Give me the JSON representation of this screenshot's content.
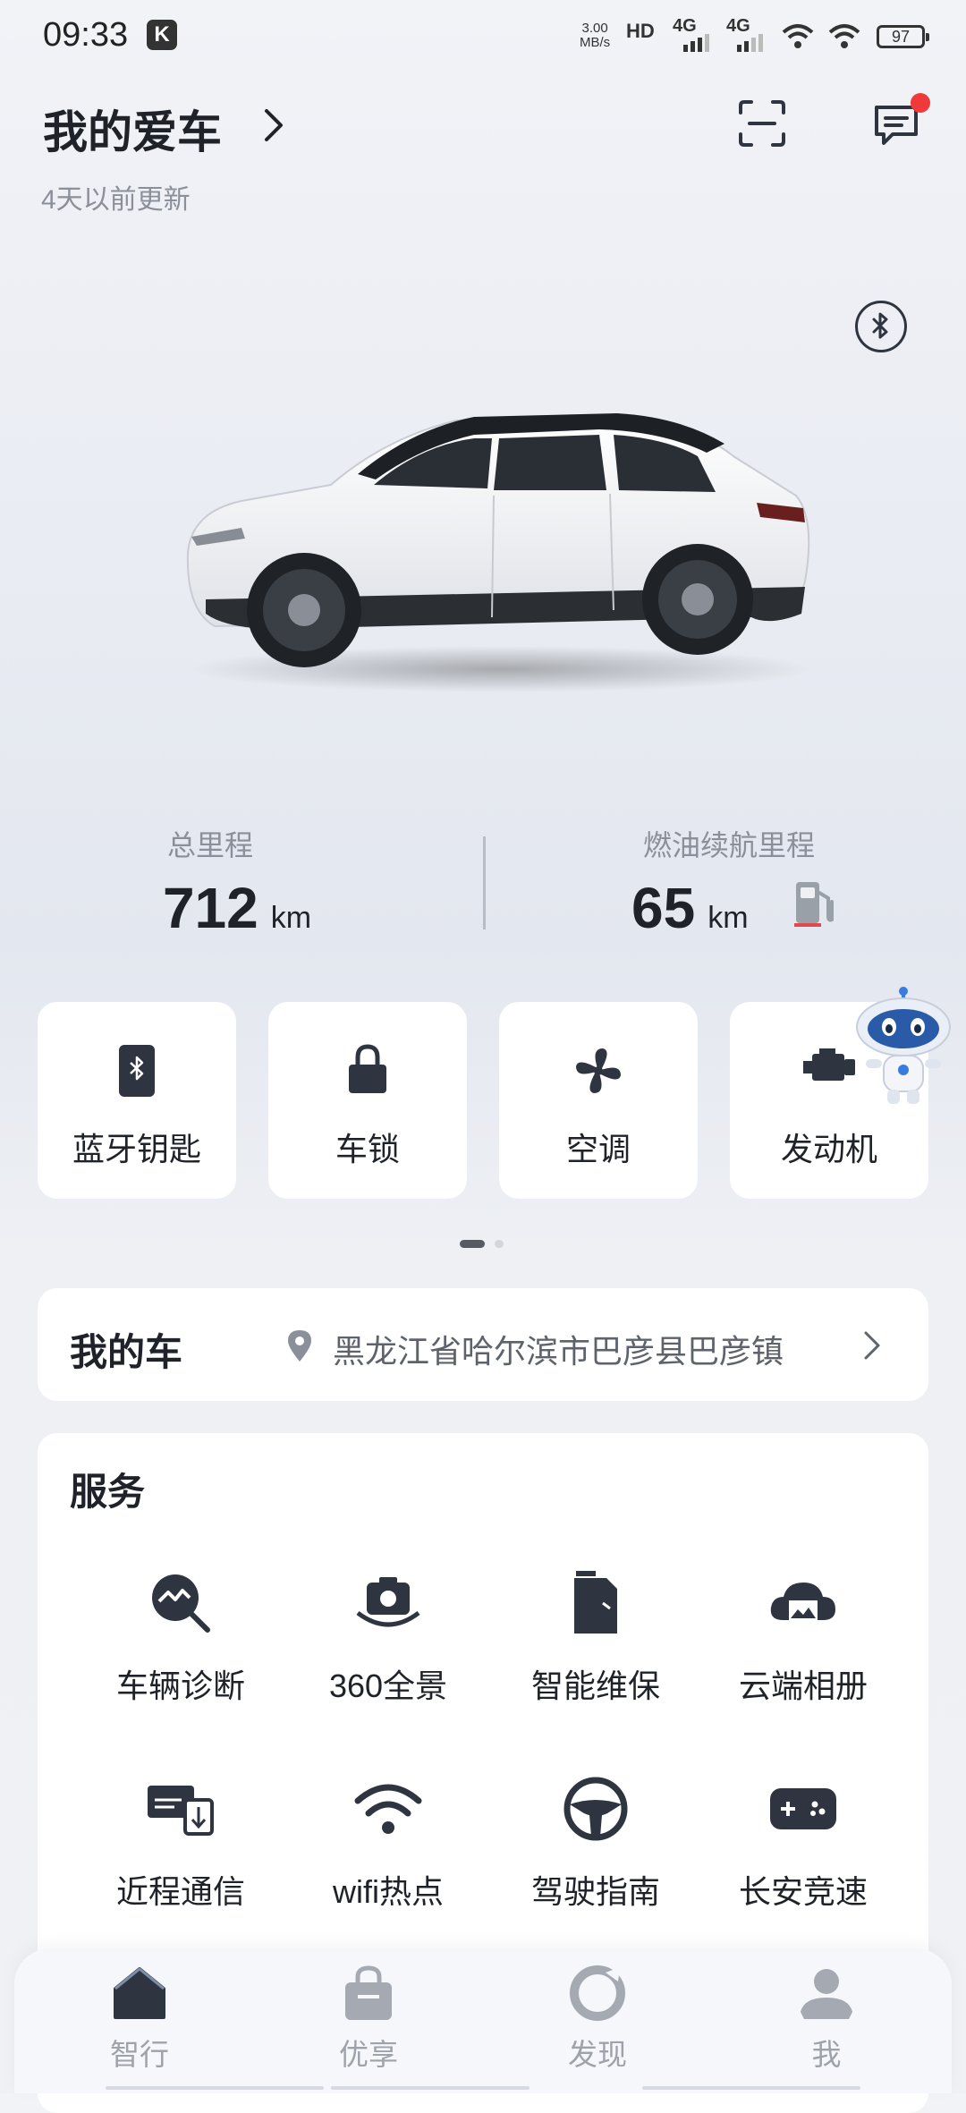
{
  "status_bar": {
    "time": "09:33",
    "app_badge": "K",
    "net_speed_value": "3.00",
    "net_speed_unit": "MB/s",
    "hd_label": "HD",
    "signal1": "4G",
    "signal2": "4G",
    "battery": "97"
  },
  "header": {
    "title": "我的爱车",
    "updated": "4天以前更新"
  },
  "stats": {
    "mileage_label": "总里程",
    "mileage_value": "712",
    "mileage_unit": "km",
    "range_label": "燃油续航里程",
    "range_value": "65",
    "range_unit": "km"
  },
  "quick_controls": [
    {
      "label": "蓝牙钥匙",
      "icon": "bluetooth-key-icon"
    },
    {
      "label": "车锁",
      "icon": "lock-icon"
    },
    {
      "label": "空调",
      "icon": "fan-icon"
    },
    {
      "label": "发动机",
      "icon": "engine-icon"
    }
  ],
  "my_car": {
    "label": "我的车",
    "address": "黑龙江省哈尔滨市巴彦县巴彦镇"
  },
  "services": {
    "title": "服务",
    "items": [
      {
        "label": "车辆诊断",
        "icon": "diagnosis-icon"
      },
      {
        "label": "360全景",
        "icon": "camera-360-icon"
      },
      {
        "label": "智能维保",
        "icon": "maintenance-icon"
      },
      {
        "label": "云端相册",
        "icon": "cloud-album-icon"
      },
      {
        "label": "近程通信",
        "icon": "near-field-icon"
      },
      {
        "label": "wifi热点",
        "icon": "wifi-icon"
      },
      {
        "label": "驾驶指南",
        "icon": "steering-wheel-icon"
      },
      {
        "label": "长安竞速",
        "icon": "gamepad-icon"
      }
    ]
  },
  "bottom_nav": [
    {
      "label": "智行",
      "icon": "home-icon"
    },
    {
      "label": "优享",
      "icon": "bag-icon"
    },
    {
      "label": "发现",
      "icon": "discover-icon"
    },
    {
      "label": "我",
      "icon": "profile-icon"
    }
  ],
  "colors": {
    "accent_dark": "#2f3540",
    "notification": "#f03a3a",
    "muted_text": "#8a8f99"
  }
}
